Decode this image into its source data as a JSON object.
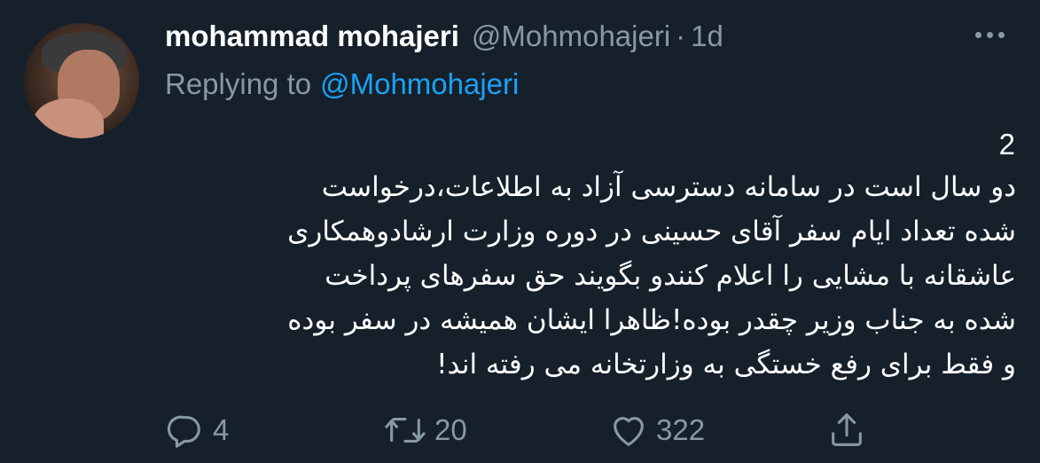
{
  "tweet": {
    "display_name": "mohammad mohajeri",
    "handle": "@Mohmohajeri",
    "separator": "·",
    "time": "1d",
    "replying_label": "Replying to",
    "replying_to": "@Mohmohajeri",
    "thread_number": "2",
    "text": "دو سال است در سامانه دسترسی آزاد به اطلاعات،درخواست\nشده تعداد ایام سفر آقای حسینی در دوره وزارت ارشادوهمکاری\nعاشقانه با مشایی را اعلام کنندو بگویند حق سفرهای پرداخت\nشده به جناب وزیر چقدر بوده!ظاهرا ایشان همیشه در سفر بوده\nو فقط برای رفع خستگی به وزارتخانه می رفته اند!",
    "stats": {
      "replies": "4",
      "retweets": "20",
      "likes": "322"
    }
  },
  "icons": {
    "reply": "reply-icon",
    "retweet": "retweet-icon",
    "like": "heart-icon",
    "share": "share-icon",
    "more": "more-icon"
  },
  "colors": {
    "background": "#15202b",
    "secondary_text": "#8899a6",
    "mention": "#1da1f2",
    "primary_text": "#ffffff"
  }
}
